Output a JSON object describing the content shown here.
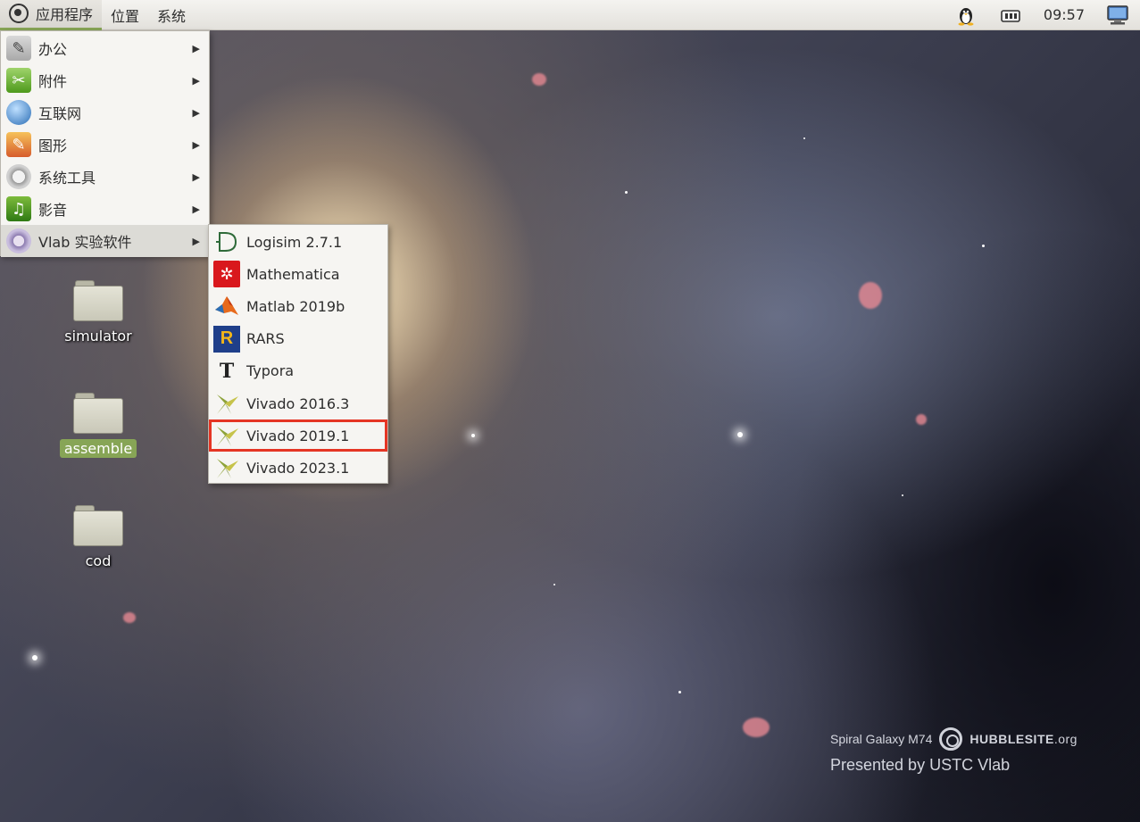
{
  "top_panel": {
    "menus": [
      "应用程序",
      "位置",
      "系统"
    ],
    "clock": "09:57",
    "tray_icons": [
      "tux-icon",
      "network-icon",
      "monitor-icon"
    ]
  },
  "app_menu": {
    "items": [
      {
        "label": "办公",
        "icon": "office-icon"
      },
      {
        "label": "附件",
        "icon": "accessories-icon"
      },
      {
        "label": "互联网",
        "icon": "internet-icon"
      },
      {
        "label": "图形",
        "icon": "graphics-icon"
      },
      {
        "label": "系统工具",
        "icon": "system-tools-icon"
      },
      {
        "label": "影音",
        "icon": "media-icon"
      },
      {
        "label": "Vlab 实验软件",
        "icon": "vlab-icon"
      }
    ],
    "highlighted_index": 6
  },
  "vlab_submenu": {
    "items": [
      {
        "label": "Logisim 2.7.1",
        "icon": "logisim-icon"
      },
      {
        "label": "Mathematica",
        "icon": "mathematica-icon"
      },
      {
        "label": "Matlab 2019b",
        "icon": "matlab-icon"
      },
      {
        "label": "RARS",
        "icon": "rars-icon"
      },
      {
        "label": "Typora",
        "icon": "typora-icon"
      },
      {
        "label": "Vivado 2016.3",
        "icon": "vivado-icon"
      },
      {
        "label": "Vivado 2019.1",
        "icon": "vivado-icon"
      },
      {
        "label": "Vivado 2023.1",
        "icon": "vivado-icon"
      }
    ],
    "boxed_index": 6,
    "box_color": "#e53524"
  },
  "desktop": {
    "icons": [
      {
        "label": "simulator",
        "selected": false
      },
      {
        "label": "assemble",
        "selected": true
      },
      {
        "label": "cod",
        "selected": false
      }
    ],
    "credit": {
      "caption": "Spiral Galaxy M74",
      "site_bold": "HUBBLESITE",
      "site_suffix": ".org",
      "presented": "Presented by USTC Vlab"
    }
  },
  "colors": {
    "selection_green": "#87a556",
    "panel_bg": "#f0efeb"
  }
}
